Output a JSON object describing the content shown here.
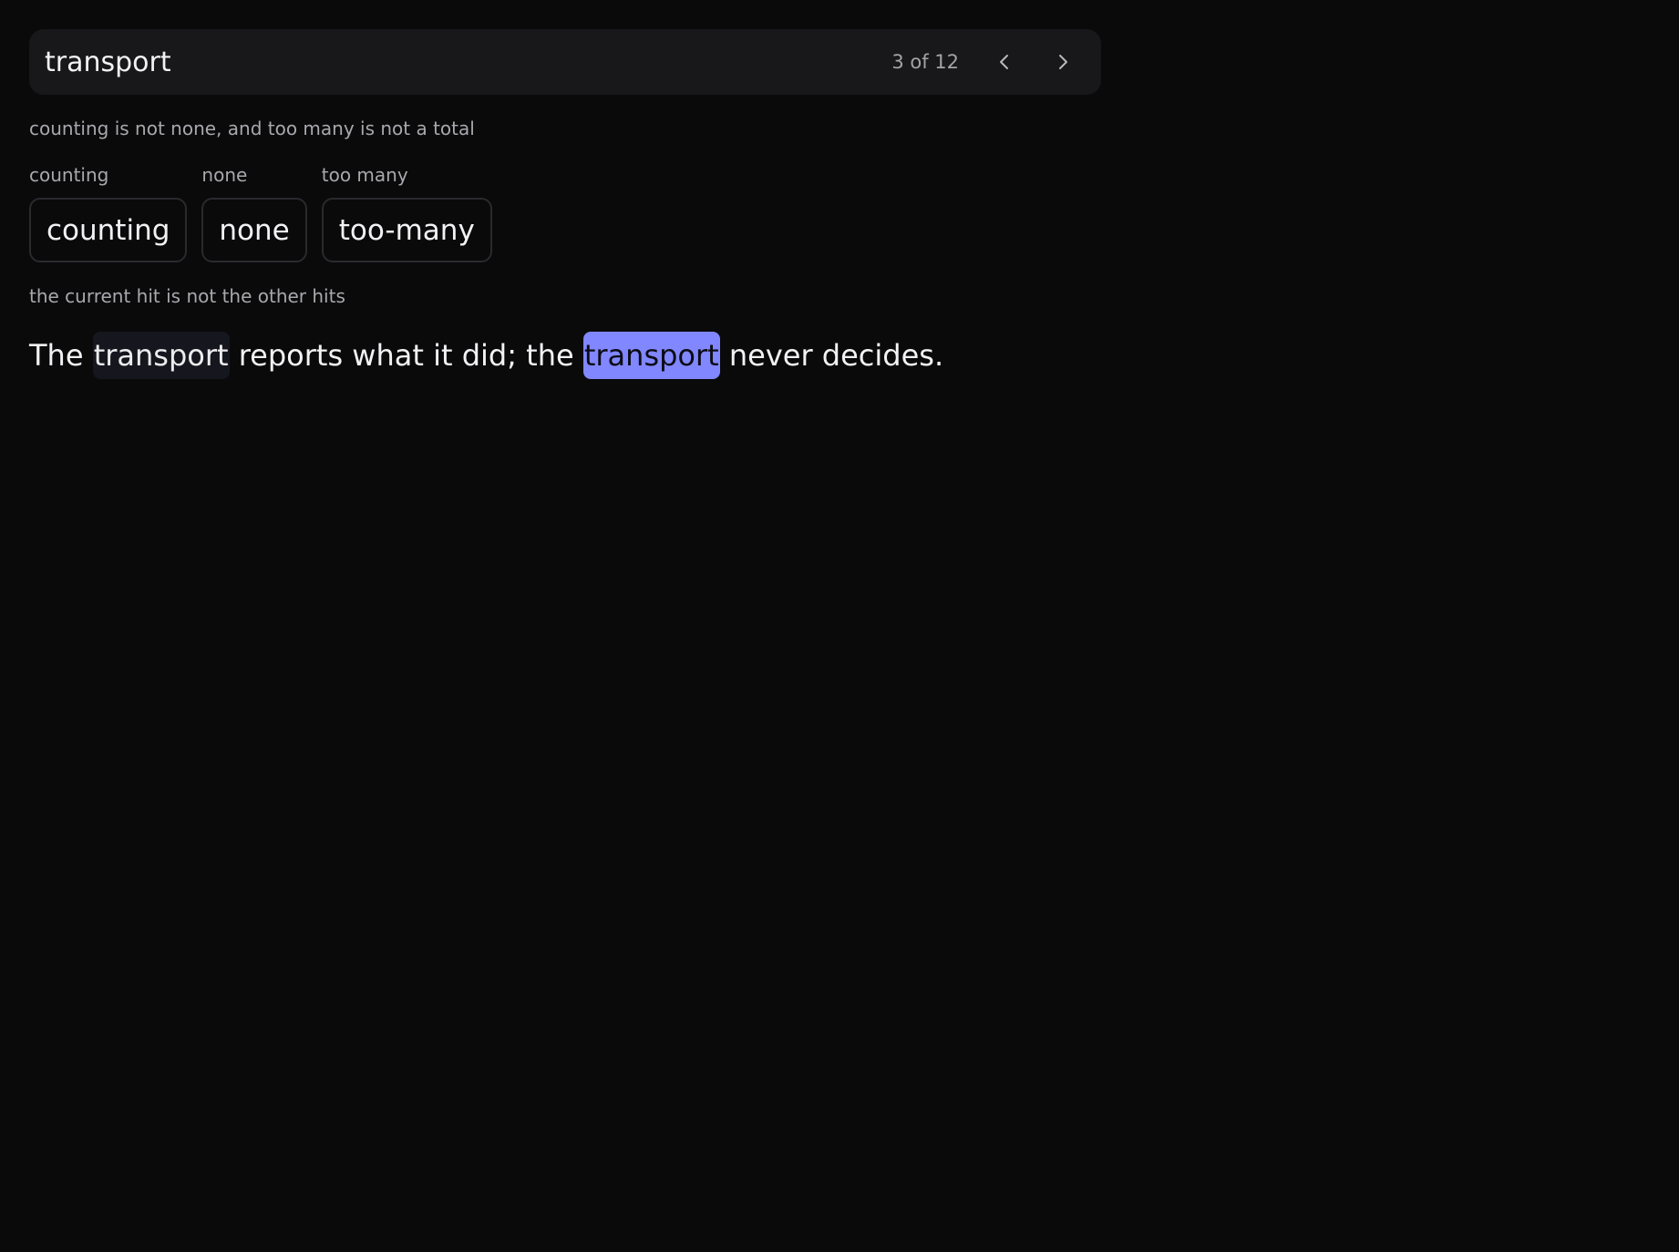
{
  "search": {
    "query": "transport",
    "match_count": "3 of 12",
    "prev_icon": "chevron-left-icon",
    "next_icon": "chevron-right-icon"
  },
  "notes": {
    "chips_note": "counting is not none, and too many is not a total",
    "hits_note": "the current hit is not the other hits"
  },
  "chips": [
    {
      "caption": "counting",
      "label": "counting"
    },
    {
      "caption": "none",
      "label": "none"
    },
    {
      "caption": "too many",
      "label": "too-many"
    }
  ],
  "sentence": {
    "part1": "The ",
    "hit1": "transport",
    "part2": " reports what it did; the ",
    "hit2": "transport",
    "part3": " never decides."
  },
  "colors": {
    "background": "#0a0a0b",
    "search_bar": "#18181a",
    "current_hit": "#8187ff",
    "other_hit": "#16161f",
    "chip_border": "#2a2a2e"
  }
}
